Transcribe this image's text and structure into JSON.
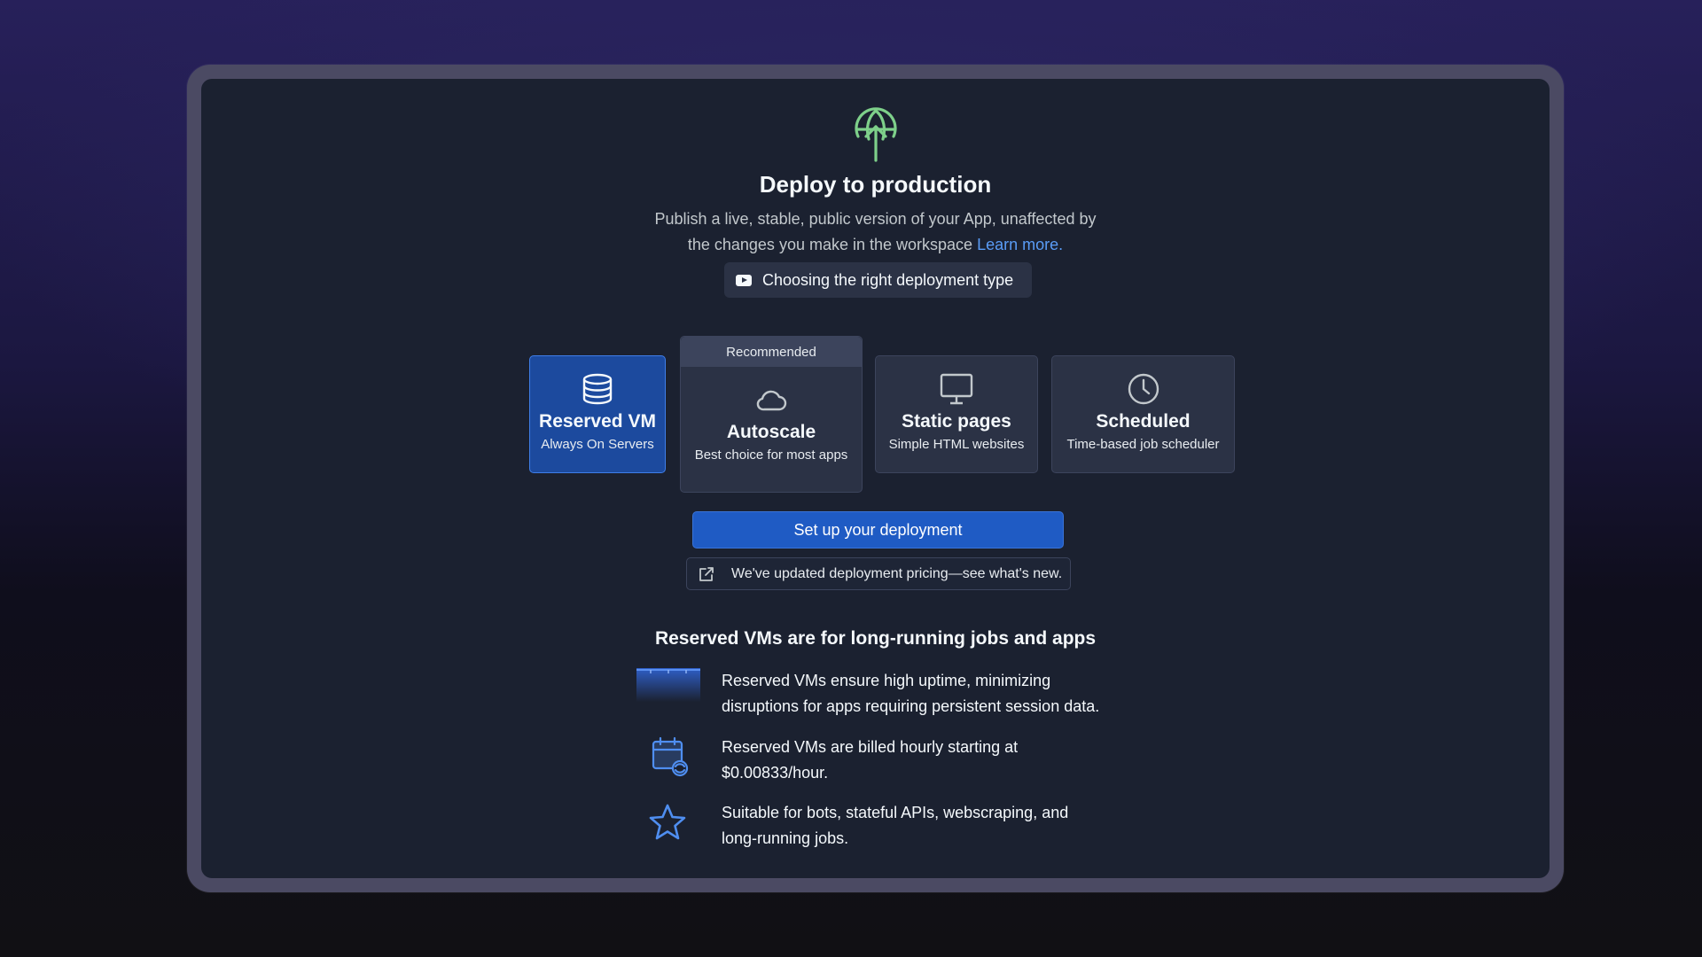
{
  "header": {
    "title": "Deploy to production",
    "subtitle_line1": "Publish a live, stable, public version of your App, unaffected by",
    "subtitle_line2": "the changes you make in the workspace",
    "learn_more": "Learn more.",
    "video_chip": "Choosing the right deployment type"
  },
  "deployment_types": [
    {
      "title": "Reserved VM",
      "subtitle": "Always On Servers",
      "icon": "database-icon",
      "selected": true
    },
    {
      "title": "Autoscale",
      "subtitle": "Best choice for most apps",
      "icon": "cloud-icon",
      "badge": "Recommended"
    },
    {
      "title": "Static pages",
      "subtitle": "Simple HTML websites",
      "icon": "monitor-icon"
    },
    {
      "title": "Scheduled",
      "subtitle": "Time-based job scheduler",
      "icon": "clock-icon"
    }
  ],
  "actions": {
    "setup_button": "Set up your deployment",
    "pricing_notice": "We've updated deployment pricing—see what's new."
  },
  "details": {
    "title": "Reserved VMs are for long-running jobs and apps",
    "features": [
      {
        "icon": "server-bar-icon",
        "line1": "Reserved VMs ensure high uptime, minimizing",
        "line2": "disruptions for apps requiring persistent session data."
      },
      {
        "icon": "calendar-repeat-icon",
        "line1": "Reserved VMs are billed hourly starting at",
        "line2": "$0.00833/hour."
      },
      {
        "icon": "star-icon",
        "line1": "Suitable for bots, stateful APIs, webscraping, and",
        "line2": "long-running jobs."
      }
    ]
  },
  "colors": {
    "accent_green": "#7ed08a",
    "primary_blue": "#1f5bc4",
    "link_blue": "#5a9cf6",
    "panel_bg": "#1b2130"
  }
}
